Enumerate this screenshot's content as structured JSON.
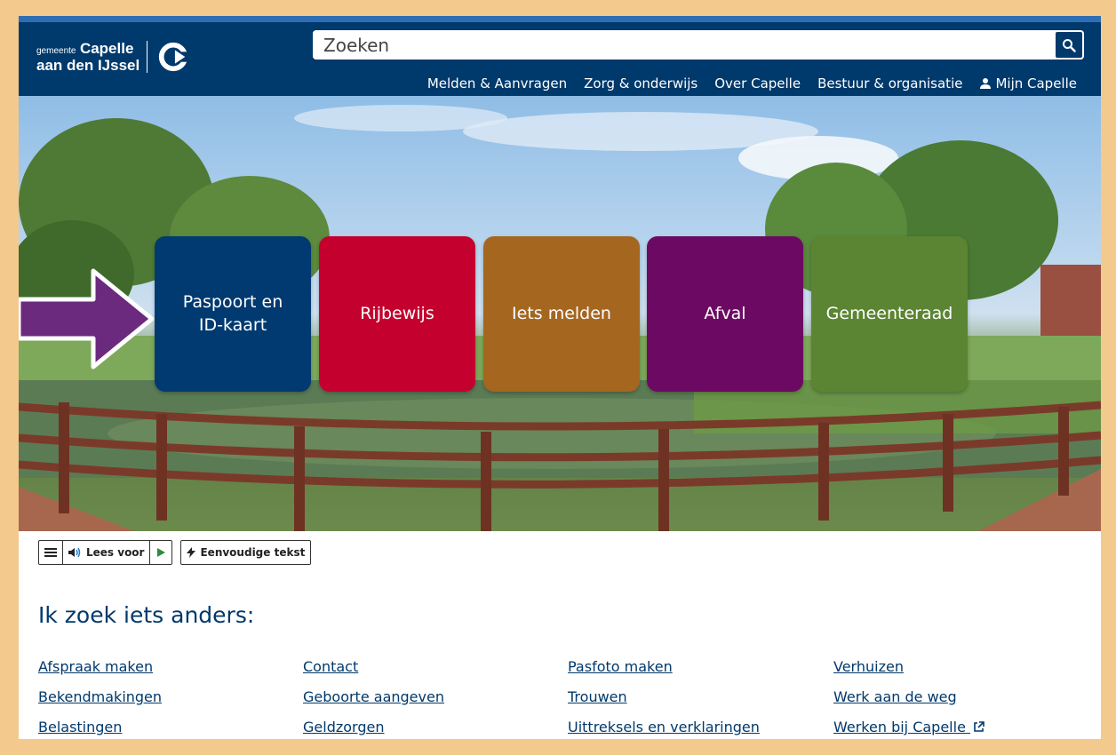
{
  "header": {
    "logo": {
      "small": "gemeente",
      "name": "Capelle",
      "line2": "aan den IJssel"
    },
    "search": {
      "placeholder": "Zoeken"
    },
    "nav": [
      "Melden & Aanvragen",
      "Zorg & onderwijs",
      "Over Capelle",
      "Bestuur & organisatie",
      "Mijn Capelle"
    ]
  },
  "tiles": [
    {
      "label": "Paspoort en ID-kaart",
      "color": "#003a70"
    },
    {
      "label": "Rijbewijs",
      "color": "#c4002f"
    },
    {
      "label": "Iets melden",
      "color": "#a5661f"
    },
    {
      "label": "Afval",
      "color": "#6c0a63"
    },
    {
      "label": "Gemeenteraad",
      "color": "#5b8532"
    }
  ],
  "arrow_color": "#6b2a7d",
  "toolbar": {
    "read_aloud": "Lees voor",
    "simple_text": "Eenvoudige tekst"
  },
  "section": {
    "title": "Ik zoek iets anders:",
    "links": [
      [
        "Afspraak maken",
        "Contact",
        "Pasfoto maken",
        "Verhuizen"
      ],
      [
        "Bekendmakingen",
        "Geboorte aangeven",
        "Trouwen",
        "Werk aan de weg"
      ],
      [
        "Belastingen",
        "Geldzorgen",
        "Uittreksels en verklaringen",
        "Werken bij Capelle"
      ]
    ]
  },
  "colors": {
    "brand": "#00396b",
    "frame": "#f3c98e"
  }
}
